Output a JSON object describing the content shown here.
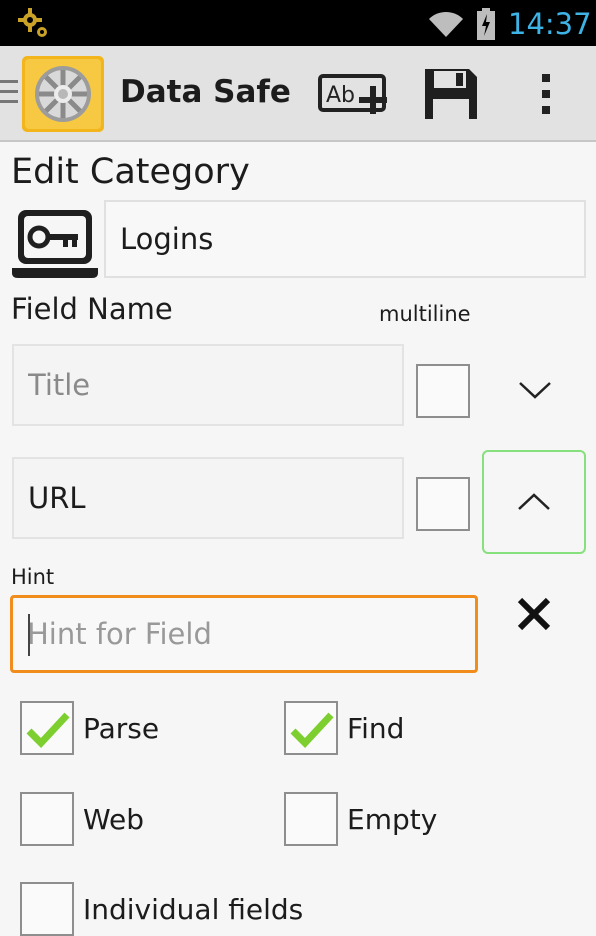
{
  "status_bar": {
    "time": "14:37",
    "icons": [
      "settings-notification-icon",
      "wifi-icon",
      "battery-charging-icon"
    ]
  },
  "action_bar": {
    "app_title": "Data Safe",
    "app_icon": "safe-icon",
    "actions": [
      {
        "name": "rename-icon"
      },
      {
        "name": "save-icon"
      },
      {
        "name": "overflow-menu-icon"
      }
    ]
  },
  "page": {
    "heading": "Edit Category"
  },
  "category": {
    "icon": "key-laptop-icon",
    "name": "Logins"
  },
  "fields": {
    "header_label": "Field Name",
    "multiline_label": "multiline",
    "items": [
      {
        "value": "Title",
        "multiline": false,
        "arrow": "chevron-down-icon"
      },
      {
        "value": "URL",
        "multiline": false,
        "arrow": "chevron-up-icon"
      }
    ]
  },
  "hint": {
    "label": "Hint",
    "placeholder": "Hint for Field",
    "value": ""
  },
  "options": [
    {
      "label": "Parse",
      "checked": true
    },
    {
      "label": "Find",
      "checked": true
    },
    {
      "label": "Web",
      "checked": false
    },
    {
      "label": "Empty",
      "checked": false
    },
    {
      "label": "Individual fields",
      "checked": false
    }
  ],
  "colors": {
    "status_time": "#3eb3e6",
    "hint_focus_border": "#f08d1d",
    "arrow_focus_border": "#86e07d",
    "check_green": "#7ccf2f",
    "action_bar_bg": "#e2e2e2"
  }
}
